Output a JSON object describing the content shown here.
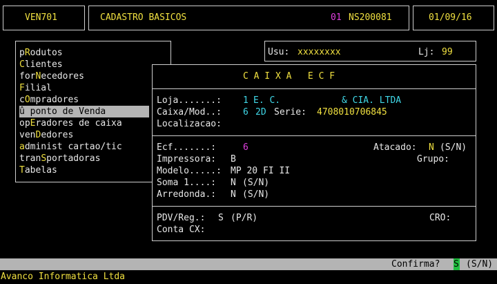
{
  "header": {
    "program": "VEN701",
    "title": "CADASTRO BASICOS",
    "company_num": "01",
    "system_code": "NS200081",
    "date": "01/09/16"
  },
  "user_bar": {
    "usu_label": "Usu:",
    "usu_value": "xxxxxxxx",
    "lj_label": "Lj:",
    "lj_value": "99"
  },
  "menu": {
    "items": [
      {
        "pre": "p",
        "hk": "R",
        "post": "odutos"
      },
      {
        "pre": "",
        "hk": "C",
        "post": "lientes"
      },
      {
        "pre": "for",
        "hk": "N",
        "post": "ecedores"
      },
      {
        "pre": "",
        "hk": "F",
        "post": "ilial"
      },
      {
        "pre": "c",
        "hk": "O",
        "post": "mpradores"
      },
      {
        "pre": "û ponto de ",
        "hk": "V",
        "post": "enda"
      },
      {
        "pre": "op",
        "hk": "E",
        "post": "radores de caixa"
      },
      {
        "pre": "ven",
        "hk": "D",
        "post": "edores"
      },
      {
        "pre": "",
        "hk": "a",
        "post": "dminist cartao/tic"
      },
      {
        "pre": "tran",
        "hk": "S",
        "post": "portadoras"
      },
      {
        "pre": "",
        "hk": "T",
        "post": "abelas"
      }
    ]
  },
  "dialog": {
    "title": "C A I X A   E C F",
    "loja_label": "Loja.......:",
    "loja_num": "1",
    "loja_name": "E. C.",
    "loja_name2": "& CIA. LTDA",
    "caixa_label": "Caixa/Mod..:",
    "caixa_num": "6",
    "caixa_mod": "2D",
    "serie_label": "Serie:",
    "serie_value": "4708010706845",
    "localizacao_label": "Localizacao:",
    "ecf_label": "Ecf.......:",
    "ecf_value": "6",
    "atacado_label": "Atacado:",
    "atacado_value": "N",
    "atacado_hint": "(S/N)",
    "impressora_label": "Impressora:",
    "impressora_value": "B",
    "grupo_label": "Grupo:",
    "modelo_label": "Modelo.....:",
    "modelo_value": "MP 20 FI II",
    "soma_label": "Soma 1....:",
    "soma_value": "N",
    "soma_hint": "(S/N)",
    "arredonda_label": "Arredonda.:",
    "arredonda_value": "N",
    "arredonda_hint": "(S/N)",
    "pdv_label": "PDV/Reg.:",
    "pdv_value": "S",
    "pdv_hint": "(P/R)",
    "cro_label": "CRO:",
    "conta_label": "Conta CX:"
  },
  "status": {
    "confirma_label": "Confirma?",
    "confirma_value": "S",
    "confirma_hint": "(S/N)"
  },
  "footer": {
    "company": "Avanco Informatica Ltda"
  }
}
